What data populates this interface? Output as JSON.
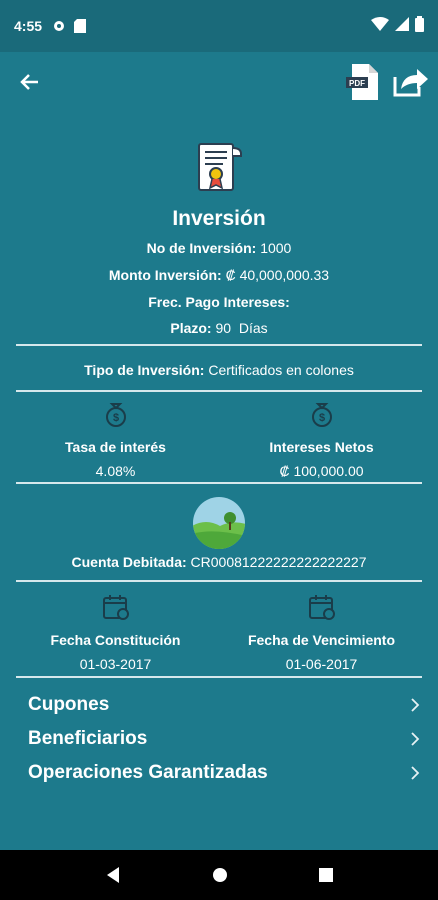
{
  "status": {
    "time": "4:55"
  },
  "header": {
    "title": "Inversión"
  },
  "details": {
    "numero_label": "No de Inversión:",
    "numero_value": "1000",
    "monto_label": "Monto Inversión:",
    "monto_value": "₡ 40,000,000.33",
    "frec_label": "Frec. Pago Intereses:",
    "frec_value": "",
    "plazo_label": "Plazo:",
    "plazo_value": "90  Días"
  },
  "tipo": {
    "label": "Tipo de Inversión:",
    "value": "Certificados en colones"
  },
  "tasa": {
    "label": "Tasa de interés",
    "value": "4.08%"
  },
  "intereses": {
    "label": "Intereses Netos",
    "value": "₡ 100,000.00"
  },
  "cuenta": {
    "label": "Cuenta Debitada:",
    "value": "CR00081222222222222227"
  },
  "fecha_constitucion": {
    "label": "Fecha Constitución",
    "value": "01-03-2017"
  },
  "fecha_vencimiento": {
    "label": "Fecha de Vencimiento",
    "value": "01-06-2017"
  },
  "menu": [
    {
      "label": "Cupones"
    },
    {
      "label": "Beneficiarios"
    },
    {
      "label": "Operaciones Garantizadas"
    }
  ],
  "icons": {
    "back": "arrow-left-icon",
    "pdf": "pdf-file-icon",
    "share": "share-icon",
    "certificate": "certificate-icon",
    "money_bag": "money-bag-icon",
    "landscape": "landscape-icon",
    "calendar": "calendar-icon",
    "chevron": "chevron-right-icon"
  },
  "colors": {
    "background": "#1d7a8c",
    "status_bar": "#1a6a7a",
    "divider": "#d6e8ec",
    "nav_bar": "#000000"
  }
}
